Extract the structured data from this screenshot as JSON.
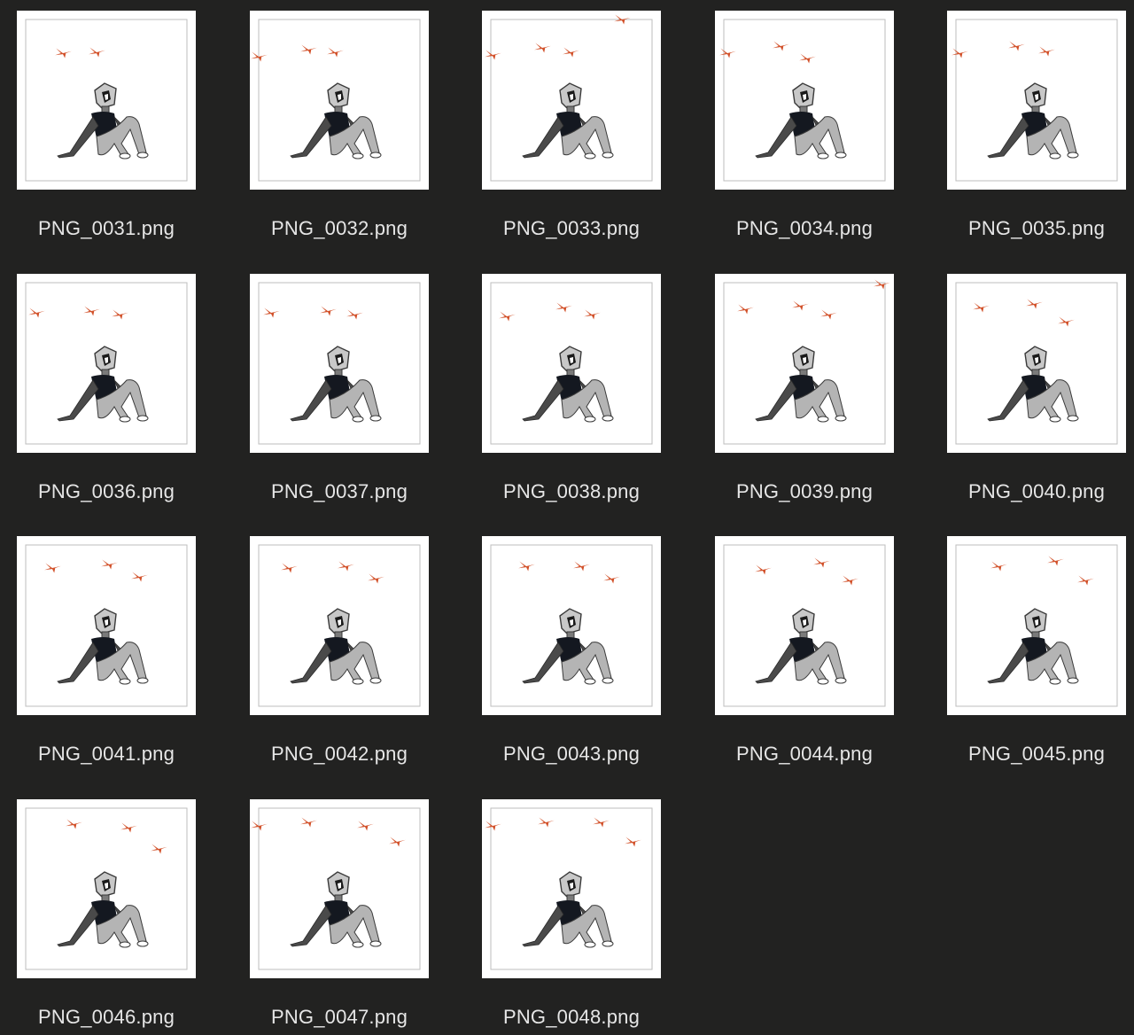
{
  "window": {
    "view": "icon-grid",
    "background_color": "#222221"
  },
  "colors": {
    "bird": "#d2512a",
    "shirt": "#141820",
    "pants": "#b4b4b4",
    "skin": "#4a4a4a",
    "frame": "#ffffff"
  },
  "files": [
    {
      "name": "PNG_0031.png"
    },
    {
      "name": "PNG_0032.png"
    },
    {
      "name": "PNG_0033.png"
    },
    {
      "name": "PNG_0034.png"
    },
    {
      "name": "PNG_0035.png"
    },
    {
      "name": "PNG_0036.png"
    },
    {
      "name": "PNG_0037.png"
    },
    {
      "name": "PNG_0038.png"
    },
    {
      "name": "PNG_0039.png"
    },
    {
      "name": "PNG_0040.png"
    },
    {
      "name": "PNG_0041.png"
    },
    {
      "name": "PNG_0042.png"
    },
    {
      "name": "PNG_0043.png"
    },
    {
      "name": "PNG_0044.png"
    },
    {
      "name": "PNG_0045.png"
    },
    {
      "name": "PNG_0046.png"
    },
    {
      "name": "PNG_0047.png"
    },
    {
      "name": "PNG_0048.png"
    }
  ]
}
